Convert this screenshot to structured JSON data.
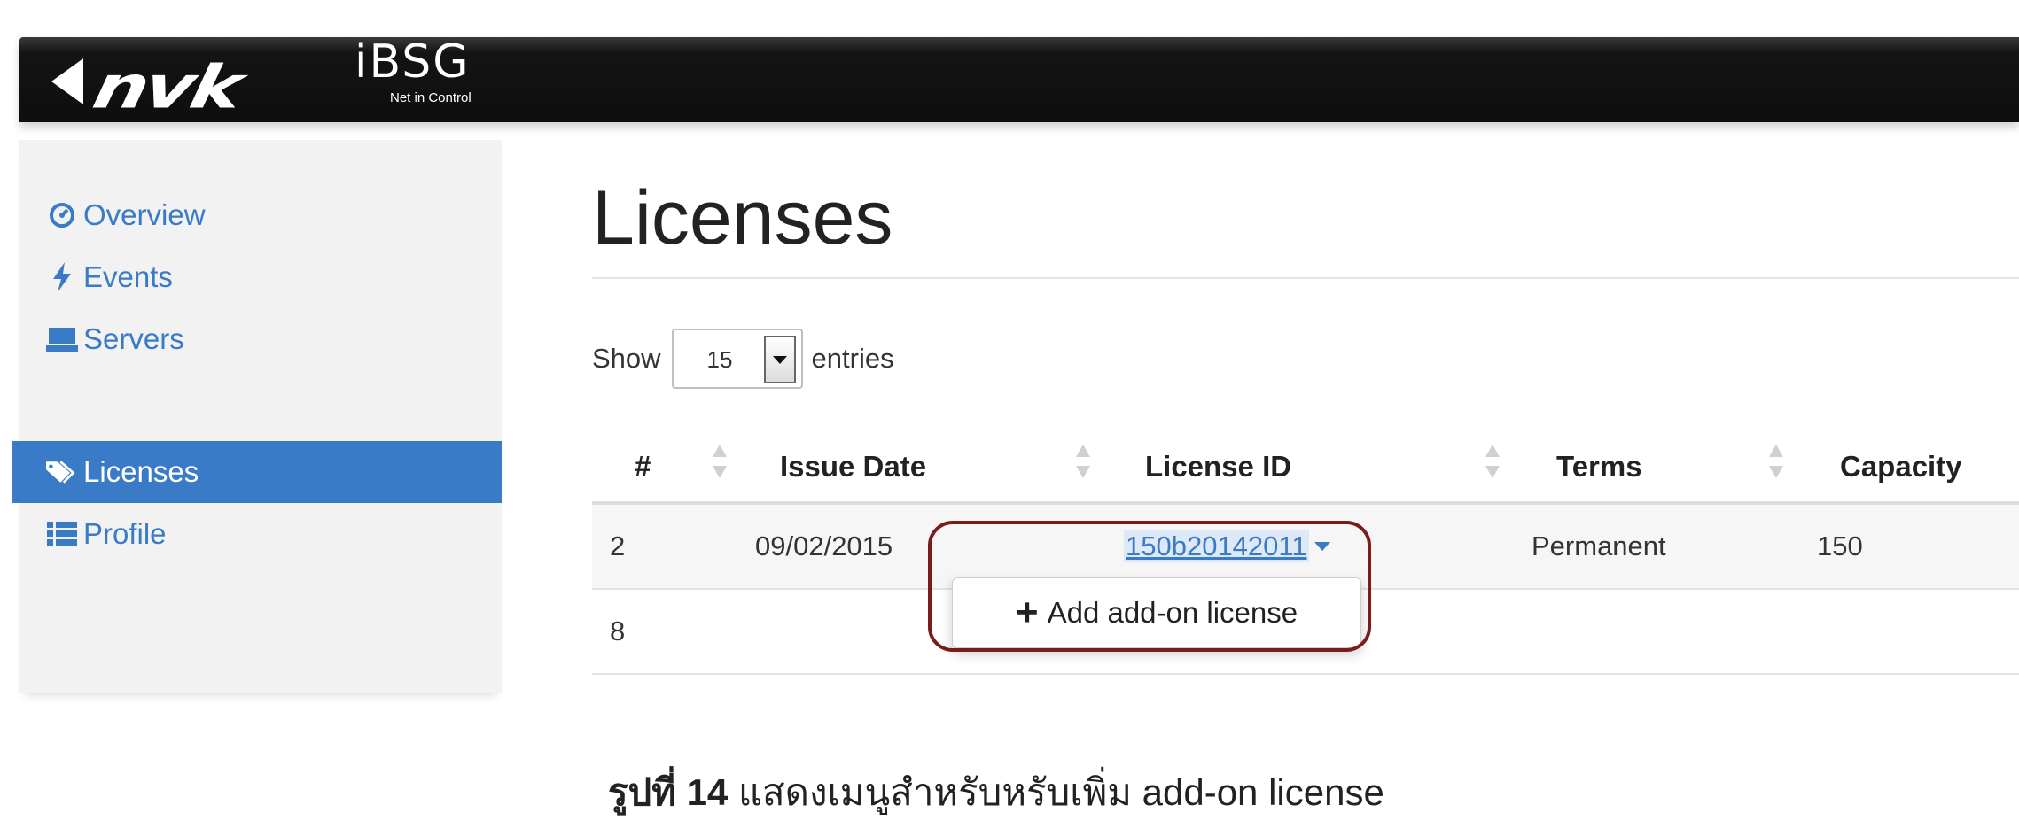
{
  "brand": {
    "product": "iBSG",
    "tagline": "Net in Control"
  },
  "sidebar": {
    "items": [
      {
        "label": "Overview",
        "icon": "dashboard-icon"
      },
      {
        "label": "Events",
        "icon": "bolt-icon"
      },
      {
        "label": "Servers",
        "icon": "server-icon"
      },
      {
        "label": "Licenses",
        "icon": "tags-icon",
        "active": true
      },
      {
        "label": "Profile",
        "icon": "list-icon"
      }
    ]
  },
  "page": {
    "title": "Licenses"
  },
  "length_menu": {
    "prefix": "Show",
    "value": "15",
    "suffix": "entries"
  },
  "table": {
    "columns": [
      "#",
      "Issue Date",
      "License ID",
      "Terms",
      "Capacity"
    ],
    "rows": [
      {
        "num": "2",
        "issue_date": "09/02/2015",
        "license_id": "150b20142011",
        "terms": "Permanent",
        "capacity": "150"
      },
      {
        "num": "8",
        "issue_date": "",
        "license_id": "",
        "terms": "",
        "capacity": ""
      }
    ]
  },
  "dropdown": {
    "item_label": "Add add-on license"
  },
  "caption": {
    "prefix": "รูปที่ 14",
    "text": " แสดงเมนูสำหรับหรับเพิ่ม add-on license"
  },
  "colors": {
    "accent": "#3a7bc8",
    "navbar": "#111111",
    "highlight_border": "#7a1c1c"
  }
}
